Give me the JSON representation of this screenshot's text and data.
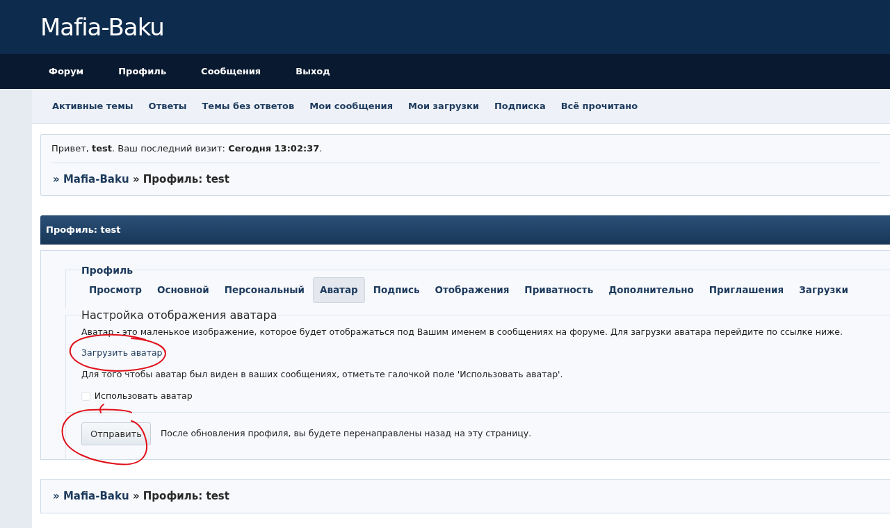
{
  "site_title": "Mafia-Baku",
  "main_nav": [
    "Форум",
    "Профиль",
    "Сообщения",
    "Выход"
  ],
  "sub_nav": [
    "Активные темы",
    "Ответы",
    "Темы без ответов",
    "Мои сообщения",
    "Мои загрузки",
    "Подписка",
    "Всё прочитано"
  ],
  "welcome": "Привет, **test**.  Ваш последний визит: **Сегодня 13:02:37**.",
  "breadcrumb": [
    {
      "label": "» Mafia-Baku",
      "kind": "link"
    },
    {
      "label": "» Профиль: test",
      "kind": "text"
    }
  ],
  "panel_title": "Профиль: test",
  "profile_tabs": {
    "legend": "Профиль",
    "tabs": [
      {
        "label": "Просмотр",
        "selected": false
      },
      {
        "label": "Основной",
        "selected": false
      },
      {
        "label": "Персональный",
        "selected": false
      },
      {
        "label": "Аватар",
        "selected": true
      },
      {
        "label": "Подпись",
        "selected": false
      },
      {
        "label": "Отображения",
        "selected": false
      },
      {
        "label": "Приватность",
        "selected": false
      },
      {
        "label": "Дополнительно",
        "selected": false
      },
      {
        "label": "Приглашения",
        "selected": false
      },
      {
        "label": "Загрузки",
        "selected": false
      }
    ]
  },
  "avatar_settings": {
    "legend": "Настройка отображения аватара",
    "description": "Аватар - это маленькое изображение, которое будет отображаться под Вашим именем в сообщениях на форуме. Для загрузки аватара перейдите по ссылке ниже.",
    "upload_link": {
      "label": "Загрузить аватар",
      "circled": true
    },
    "hint": "Для того чтобы аватар был виден в ваших сообщениях, отметьте галочкой поле 'Использовать аватар'.",
    "checkbox": {
      "label": "Использовать аватар",
      "checked": false
    }
  },
  "submit": {
    "label": "Отправить",
    "circled": true,
    "note": "После обновления профиля, вы будете перенаправлены назад на эту страницу."
  },
  "bottom_breadcrumb": [
    {
      "label": "» Mafia-Baku",
      "kind": "link"
    },
    {
      "label": "» Профиль: test",
      "kind": "text"
    }
  ]
}
